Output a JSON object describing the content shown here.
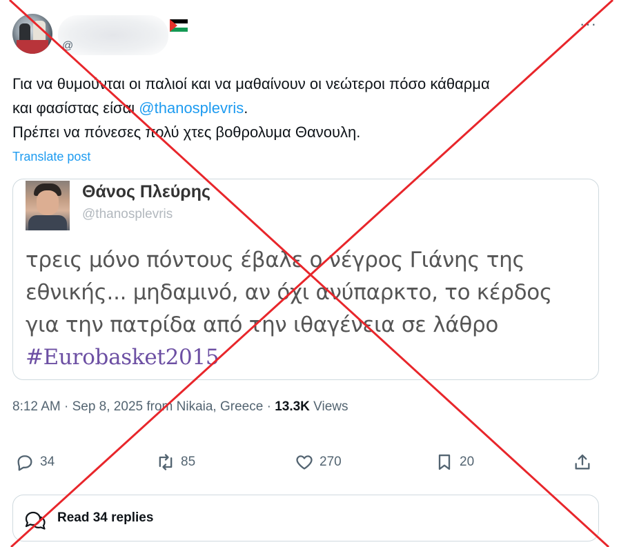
{
  "author": {
    "handle": "@",
    "flag": "palestine-flag"
  },
  "post": {
    "line1": "Για να θυμούνται οι παλιοί και να μαθαίνουν οι νεώτεροι πόσο κάθαρμα",
    "line2_prefix": "και φασίστας είσαι ",
    "mention": "@thanosplevris",
    "line2_suffix": ".",
    "line3": "Πρέπει να πόνεσες πολύ χτες βοθρολυμα Θανουλη.",
    "translate_label": "Translate post"
  },
  "quoted": {
    "name": "Θάνος Πλεύρης",
    "handle": "@thanosplevris",
    "line1": "τρεις μόνο πόντους έβαλε ο νέγρος Γιάνης της",
    "line2": "εθνικής... μηδαμινό, αν όχι ανύπαρκτο, το κέρδος",
    "line3": "για την πατρίδα από την ιθαγένεια σε λάθρο",
    "hashtag": "#Eurobasket2015"
  },
  "meta": {
    "time_date": "8:12 AM · Sep 8, 2025 from Nikaia, Greece · ",
    "views_count": "13.3K",
    "views_label": " Views"
  },
  "actions": {
    "replies": "34",
    "reposts": "85",
    "likes": "270",
    "bookmarks": "20"
  },
  "read_replies_label": "Read 34 replies",
  "overlay_color": "#e8262b"
}
